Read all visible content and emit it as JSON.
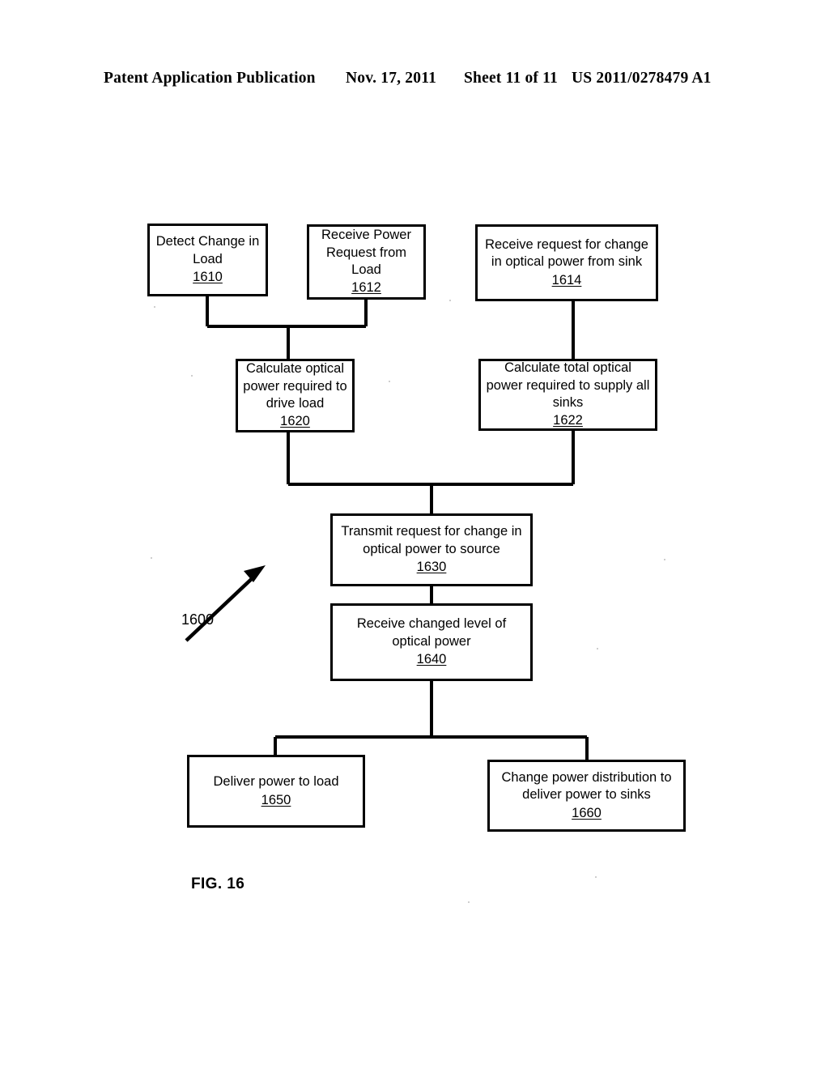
{
  "header": {
    "publication": "Patent Application Publication",
    "date": "Nov. 17, 2011",
    "sheet": "Sheet 11 of 11",
    "patent_number": "US 2011/0278479 A1"
  },
  "figure": {
    "caption": "FIG. 16",
    "diagram_reference": "1600"
  },
  "flowchart": {
    "nodes": [
      {
        "id": "1610",
        "label": "Detect Change in\nLoad",
        "ref": "1610"
      },
      {
        "id": "1612",
        "label": "Receive Power\nRequest from\nLoad",
        "ref": "1612"
      },
      {
        "id": "1614",
        "label": "Receive request for change\nin optical power from sink",
        "ref": "1614"
      },
      {
        "id": "1620",
        "label": "Calculate optical\npower required to\ndrive load",
        "ref": "1620"
      },
      {
        "id": "1622",
        "label": "Calculate total optical\npower required to supply all\nsinks",
        "ref": "1622"
      },
      {
        "id": "1630",
        "label": "Transmit request for change in\noptical power to source",
        "ref": "1630"
      },
      {
        "id": "1640",
        "label": "Receive changed level of\noptical power",
        "ref": "1640"
      },
      {
        "id": "1650",
        "label": "Deliver power to load",
        "ref": "1650"
      },
      {
        "id": "1660",
        "label": "Change power distribution to\ndeliver power to sinks",
        "ref": "1660"
      }
    ],
    "edges": [
      {
        "from": "1610",
        "to": "1620"
      },
      {
        "from": "1612",
        "to": "1620"
      },
      {
        "from": "1614",
        "to": "1622"
      },
      {
        "from": "1620",
        "to": "1630"
      },
      {
        "from": "1622",
        "to": "1630"
      },
      {
        "from": "1630",
        "to": "1640"
      },
      {
        "from": "1640",
        "to": "1650"
      },
      {
        "from": "1640",
        "to": "1660"
      }
    ]
  },
  "colors": {
    "ink": "#000000",
    "paper": "#ffffff"
  }
}
